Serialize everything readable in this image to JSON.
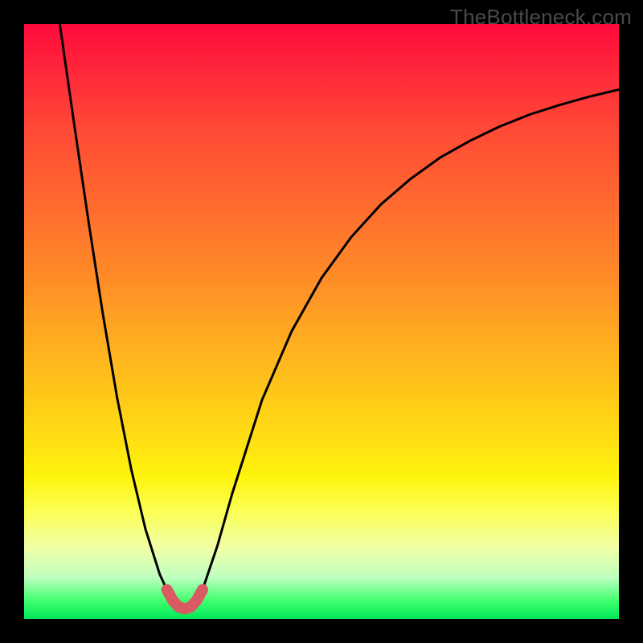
{
  "watermark": "TheBottleneck.com",
  "chart_data": {
    "type": "line",
    "title": "",
    "xlabel": "",
    "ylabel": "",
    "xlim": [
      0,
      100
    ],
    "ylim": [
      0,
      100
    ],
    "grid": false,
    "legend": null,
    "curve": {
      "name": "bottleneck-curve",
      "color": "#000000",
      "points": [
        {
          "x": 6.0,
          "y": 100.0
        },
        {
          "x": 8.4,
          "y": 83.3
        },
        {
          "x": 10.8,
          "y": 67.0
        },
        {
          "x": 13.2,
          "y": 51.5
        },
        {
          "x": 15.6,
          "y": 37.4
        },
        {
          "x": 18.0,
          "y": 25.2
        },
        {
          "x": 20.4,
          "y": 15.1
        },
        {
          "x": 22.8,
          "y": 7.5
        },
        {
          "x": 24.0,
          "y": 4.9
        },
        {
          "x": 25.0,
          "y": 3.1
        },
        {
          "x": 26.0,
          "y": 2.0
        },
        {
          "x": 27.0,
          "y": 1.7
        },
        {
          "x": 28.0,
          "y": 2.0
        },
        {
          "x": 29.0,
          "y": 3.1
        },
        {
          "x": 30.0,
          "y": 4.9
        },
        {
          "x": 32.5,
          "y": 12.3
        },
        {
          "x": 35.0,
          "y": 21.1
        },
        {
          "x": 40.0,
          "y": 36.8
        },
        {
          "x": 45.0,
          "y": 48.4
        },
        {
          "x": 50.0,
          "y": 57.3
        },
        {
          "x": 55.0,
          "y": 64.2
        },
        {
          "x": 60.0,
          "y": 69.7
        },
        {
          "x": 65.0,
          "y": 74.0
        },
        {
          "x": 70.0,
          "y": 77.6
        },
        {
          "x": 75.0,
          "y": 80.4
        },
        {
          "x": 80.0,
          "y": 82.8
        },
        {
          "x": 85.0,
          "y": 84.8
        },
        {
          "x": 90.0,
          "y": 86.4
        },
        {
          "x": 95.0,
          "y": 87.8
        },
        {
          "x": 100.0,
          "y": 89.0
        }
      ]
    },
    "red_segment": {
      "color": "#d95a63",
      "points": [
        {
          "x": 24.0,
          "y": 4.9
        },
        {
          "x": 25.0,
          "y": 3.1
        },
        {
          "x": 26.0,
          "y": 2.0
        },
        {
          "x": 27.0,
          "y": 1.7
        },
        {
          "x": 28.0,
          "y": 2.0
        },
        {
          "x": 29.0,
          "y": 3.1
        },
        {
          "x": 30.0,
          "y": 4.9
        }
      ]
    },
    "gradient_stops": [
      {
        "pos": 0,
        "color": "#ff0a3c"
      },
      {
        "pos": 9,
        "color": "#ff2b3a"
      },
      {
        "pos": 18,
        "color": "#ff4a35"
      },
      {
        "pos": 30,
        "color": "#ff6a2f"
      },
      {
        "pos": 42,
        "color": "#ff8a28"
      },
      {
        "pos": 55,
        "color": "#ffb21f"
      },
      {
        "pos": 68,
        "color": "#ffd914"
      },
      {
        "pos": 76,
        "color": "#fff40c"
      },
      {
        "pos": 82,
        "color": "#fcff56"
      },
      {
        "pos": 88,
        "color": "#f0ffa5"
      },
      {
        "pos": 93,
        "color": "#c0ffc0"
      },
      {
        "pos": 97,
        "color": "#3fff6d"
      },
      {
        "pos": 100,
        "color": "#00e85a"
      }
    ]
  }
}
